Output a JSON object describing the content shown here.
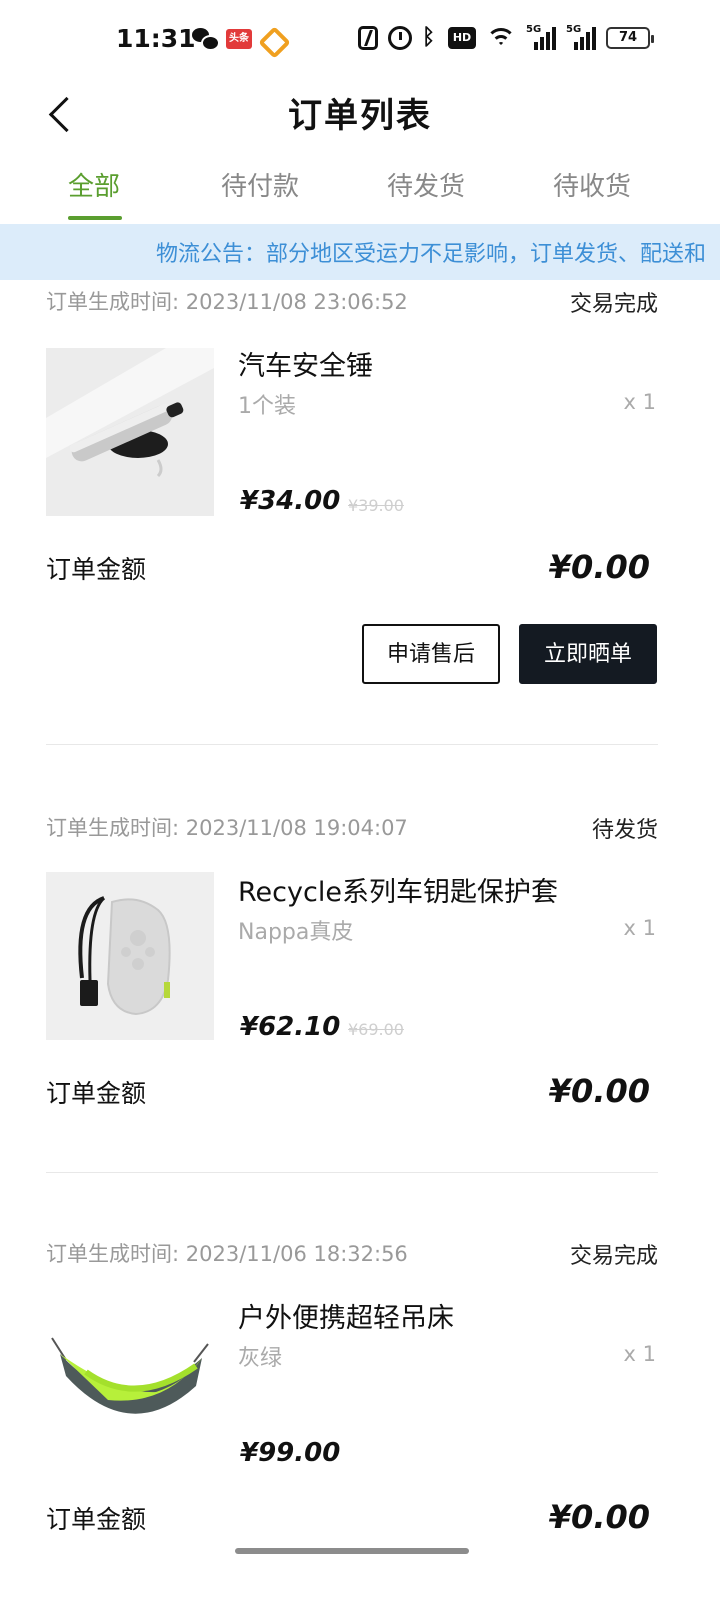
{
  "status_bar": {
    "time": "11:31",
    "toutiao_badge": "头条",
    "hd_label": "HD",
    "signal_tag": "5G",
    "battery": "74"
  },
  "header": {
    "title": "订单列表"
  },
  "tabs": [
    {
      "label": "全部",
      "active": true
    },
    {
      "label": "待付款",
      "active": false
    },
    {
      "label": "待发货",
      "active": false
    },
    {
      "label": "待收货",
      "active": false
    }
  ],
  "notice": {
    "text": "物流公告：部分地区受运力不足影响，订单发货、配送和"
  },
  "orders": [
    {
      "time_label": "订单生成时间:",
      "time": "2023/11/08 23:06:52",
      "status": "交易完成",
      "product_name": "汽车安全锤",
      "spec": "1个装",
      "qty": "x 1",
      "price": "¥34.00",
      "original_price": "¥39.00",
      "amount_label": "订单金额",
      "amount": "¥0.00",
      "buttons": [
        "申请售后",
        "立即晒单"
      ]
    },
    {
      "time_label": "订单生成时间:",
      "time": "2023/11/08 19:04:07",
      "status": "待发货",
      "product_name": "Recycle系列车钥匙保护套",
      "spec": "Nappa真皮",
      "qty": "x 1",
      "price": "¥62.10",
      "original_price": "¥69.00",
      "amount_label": "订单金额",
      "amount": "¥0.00"
    },
    {
      "time_label": "订单生成时间:",
      "time": "2023/11/06 18:32:56",
      "status": "交易完成",
      "product_name": "户外便携超轻吊床",
      "spec": "灰绿",
      "qty": "x 1",
      "price": "¥99.00",
      "amount_label": "订单金额",
      "amount": "¥0.00"
    }
  ],
  "colors": {
    "accent": "#5a9e2f",
    "notice_bg": "#dcecfa",
    "notice_text": "#3d8fd6",
    "dark_button": "#141a22"
  }
}
